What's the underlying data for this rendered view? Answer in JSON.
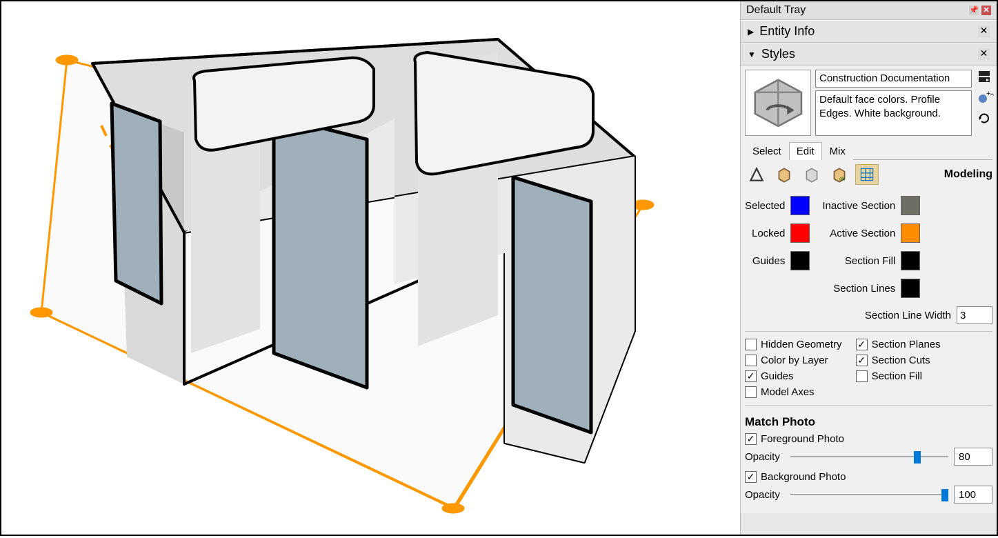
{
  "tray": {
    "title": "Default Tray",
    "panels": {
      "entity_info": {
        "title": "Entity Info",
        "expanded": false
      },
      "styles": {
        "title": "Styles",
        "expanded": true
      }
    }
  },
  "styles_panel": {
    "name": "Construction Documentation",
    "desc": "Default face colors. Profile Edges. White background.",
    "tabs": {
      "select": "Select",
      "edit": "Edit",
      "mix": "Mix",
      "active": "edit"
    },
    "mode_label": "Modeling",
    "colors_left": [
      {
        "label": "Selected",
        "hex": "#0000FF"
      },
      {
        "label": "Locked",
        "hex": "#FF0000"
      },
      {
        "label": "Guides",
        "hex": "#000000"
      }
    ],
    "colors_right": [
      {
        "label": "Inactive Section",
        "hex": "#6E6E64"
      },
      {
        "label": "Active Section",
        "hex": "#FF8C00"
      },
      {
        "label": "Section Fill",
        "hex": "#000000"
      },
      {
        "label": "Section Lines",
        "hex": "#000000"
      }
    ],
    "section_line_width_label": "Section Line Width",
    "section_line_width_value": "3",
    "checks_left": [
      {
        "label": "Hidden Geometry",
        "checked": false
      },
      {
        "label": "Color by Layer",
        "checked": false
      },
      {
        "label": "Guides",
        "checked": true
      },
      {
        "label": "Model Axes",
        "checked": false
      }
    ],
    "checks_right": [
      {
        "label": "Section Planes",
        "checked": true
      },
      {
        "label": "Section Cuts",
        "checked": true
      },
      {
        "label": "Section Fill",
        "checked": false
      }
    ],
    "match_photo": {
      "heading": "Match Photo",
      "foreground_label": "Foreground Photo",
      "foreground_checked": true,
      "opacity_label": "Opacity",
      "foreground_opacity": "80",
      "background_label": "Background Photo",
      "background_checked": true,
      "background_opacity": "100"
    }
  }
}
